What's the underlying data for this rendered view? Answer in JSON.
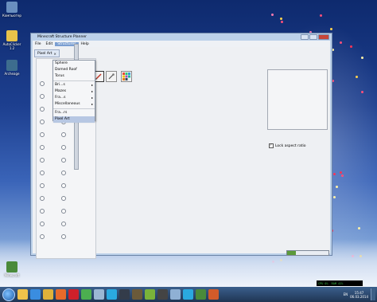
{
  "desktop": {
    "icons": [
      {
        "label": "Компьютер",
        "color": "#6a8fbf"
      },
      {
        "label": "AutoClicker 1.2",
        "color": "#e8c34a"
      },
      {
        "label": "Archeage",
        "color": "#3d6d8e"
      },
      {
        "label": "Minecraft",
        "color": "#4a8a3a"
      }
    ]
  },
  "window": {
    "title": "Minecraft Structure Planner",
    "menus": [
      "File",
      "Edit",
      "Structures",
      "Help"
    ],
    "active_menu_index": 2,
    "tab": {
      "label": "Pixel Art",
      "close": "×"
    },
    "structures_menu": {
      "items": [
        {
          "label": "Sphere",
          "submenu": false
        },
        {
          "label": "Domed Roof",
          "submenu": false
        },
        {
          "label": "Torus",
          "submenu": false
        },
        {
          "label": "Bri...s",
          "submenu": true
        },
        {
          "label": "Mazes",
          "submenu": true
        },
        {
          "label": "Fra...s",
          "submenu": true
        },
        {
          "label": "Miscellaneous",
          "submenu": true
        },
        {
          "label": "Fra...rs",
          "submenu": false
        },
        {
          "label": "Pixel Art",
          "submenu": false
        }
      ],
      "selected_index": 8
    },
    "tools": [
      {
        "icon": "pencil-icon"
      },
      {
        "icon": "picker-icon"
      },
      {
        "icon": "palette-grid-icon"
      }
    ],
    "lock_aspect_ratio": {
      "label": "Lock aspect ratio",
      "checked": true
    },
    "progress": 0.22,
    "colors": {
      "accent": "#7a9ed1",
      "window_frame": "#bcd1ea"
    }
  },
  "taskbar": {
    "apps": [
      {
        "icon": "explorer-icon",
        "color": "#f0c24a"
      },
      {
        "icon": "ie-icon",
        "color": "#3a8de0"
      },
      {
        "icon": "folder-icon",
        "color": "#e0b23a"
      },
      {
        "icon": "media-icon",
        "color": "#e86a2a"
      },
      {
        "icon": "opera-icon",
        "color": "#d0202a"
      },
      {
        "icon": "chrome-icon",
        "color": "#4caf50"
      },
      {
        "icon": "notepad-icon",
        "color": "#9bb7d4"
      },
      {
        "icon": "skype-icon",
        "color": "#2aa9e0"
      },
      {
        "icon": "steam-icon",
        "color": "#333c4a"
      },
      {
        "icon": "game-icon",
        "color": "#6b5a3a"
      },
      {
        "icon": "utorrent-icon",
        "color": "#7ab33a"
      },
      {
        "icon": "cs-icon",
        "color": "#444"
      },
      {
        "icon": "calc-icon",
        "color": "#8fb0d4"
      },
      {
        "icon": "skype2-icon",
        "color": "#2aa9e0"
      },
      {
        "icon": "minecraft-icon",
        "color": "#4a8a3a"
      },
      {
        "icon": "java-icon",
        "color": "#d35b2a"
      }
    ],
    "lang": "EN",
    "time": "15:47",
    "date": "06.03.2014",
    "gadget_text": [
      "CPU 0%",
      "RAM 41%"
    ]
  }
}
